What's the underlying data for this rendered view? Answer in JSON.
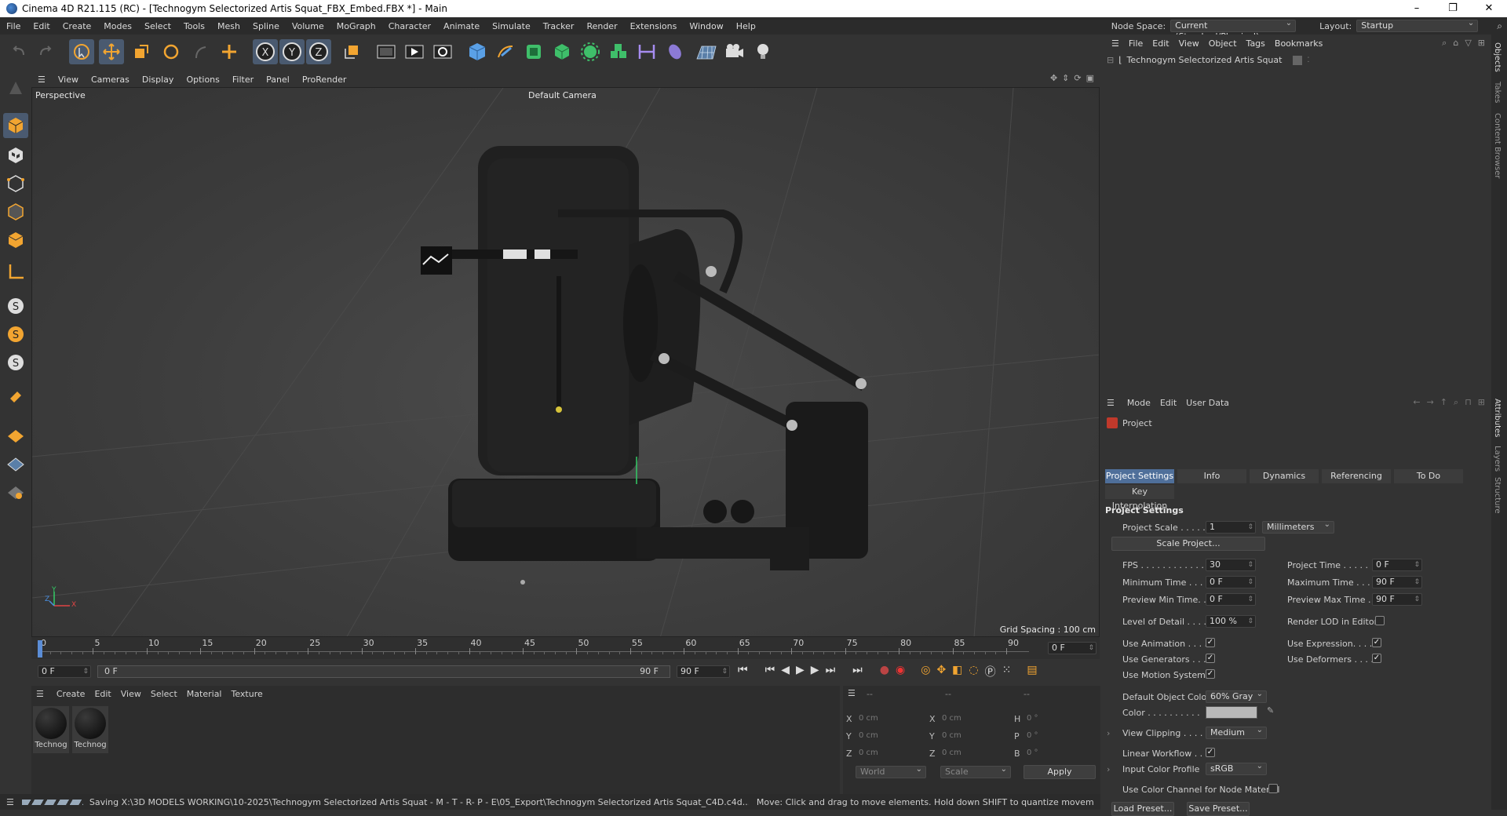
{
  "window": {
    "title": "Cinema 4D R21.115 (RC) - [Technogym Selectorized Artis Squat_FBX_Embed.FBX *] - Main",
    "controls": [
      "–",
      "❐",
      "✕"
    ]
  },
  "menubar": {
    "items": [
      "File",
      "Edit",
      "Create",
      "Modes",
      "Select",
      "Tools",
      "Mesh",
      "Spline",
      "Volume",
      "MoGraph",
      "Character",
      "Animate",
      "Simulate",
      "Tracker",
      "Render",
      "Extensions",
      "Window",
      "Help"
    ],
    "node_space_label": "Node Space:",
    "node_space_value": "Current (Standard/Physical)",
    "layout_label": "Layout:",
    "layout_value": "Startup"
  },
  "viewport": {
    "menu": [
      "View",
      "Cameras",
      "Display",
      "Options",
      "Filter",
      "Panel",
      "ProRender"
    ],
    "view_name": "Perspective",
    "camera": "Default Camera",
    "grid_spacing": "Grid Spacing : 100 cm",
    "axis_labels": {
      "y": "Y",
      "z": "Z",
      "x": "X"
    }
  },
  "timeline": {
    "ticks": [
      "0",
      "5",
      "10",
      "15",
      "20",
      "25",
      "30",
      "35",
      "40",
      "45",
      "50",
      "55",
      "60",
      "65",
      "70",
      "75",
      "80",
      "85",
      "90"
    ],
    "current_frame": "0 F"
  },
  "transport": {
    "start_field": "0 F",
    "range_start": "0 F",
    "range_end": "90 F",
    "end_field": "90 F"
  },
  "materials": {
    "menu": [
      "Create",
      "Edit",
      "View",
      "Select",
      "Material",
      "Texture"
    ],
    "items": [
      "Technog",
      "Technog"
    ]
  },
  "coords": {
    "header": [
      "--",
      "--",
      "--"
    ],
    "rows": [
      {
        "a": "X",
        "a_val": "0 cm",
        "b": "X",
        "b_val": "0 cm",
        "c": "H",
        "c_val": "0 °"
      },
      {
        "a": "Y",
        "a_val": "0 cm",
        "b": "Y",
        "b_val": "0 cm",
        "c": "P",
        "c_val": "0 °"
      },
      {
        "a": "Z",
        "a_val": "0 cm",
        "b": "Z",
        "b_val": "0 cm",
        "c": "B",
        "c_val": "0 °"
      }
    ],
    "world": "World",
    "scale": "Scale",
    "apply": "Apply"
  },
  "status": {
    "saving": "Saving X:\\3D MODELS WORKING\\10-2025\\Technogym Selectorized Artis Squat - M - T - R- P - E\\05_Export\\Technogym Selectorized Artis Squat_C4D.c4d...",
    "hint": "Move: Click and drag to move elements. Hold down SHIFT to quantize movement / add to th"
  },
  "objects": {
    "menu": [
      "File",
      "Edit",
      "View",
      "Object",
      "Tags",
      "Bookmarks"
    ],
    "item": "Technogym Selectorized Artis Squat"
  },
  "attributes": {
    "menu": [
      "Mode",
      "Edit",
      "User Data"
    ],
    "object": "Project",
    "tabs": [
      "Project Settings",
      "Info",
      "Dynamics",
      "Referencing",
      "To Do"
    ],
    "tab2": "Key Interpolation",
    "section": "Project Settings",
    "project_scale_label": "Project Scale . . . . .",
    "project_scale": "1",
    "project_scale_unit": "Millimeters",
    "scale_project_btn": "Scale Project...",
    "fps_label": "FPS . . . . . . . . . . . .",
    "fps": "30",
    "project_time_label": "Project Time . . . . .",
    "project_time": "0 F",
    "min_time_label": "Minimum Time . . . .",
    "min_time": "0 F",
    "max_time_label": "Maximum Time . . .",
    "max_time": "90 F",
    "preview_min_label": "Preview Min Time. .",
    "preview_min": "0 F",
    "preview_max_label": "Preview Max Time . .",
    "preview_max": "90 F",
    "lod_label": "Level of Detail . . . .",
    "lod": "100 %",
    "render_lod_label": "Render LOD in Editor",
    "use_animation_label": "Use Animation . . . .",
    "use_expression_label": "Use Expression. . . .",
    "use_generators_label": "Use Generators . . .",
    "use_deformers_label": "Use Deformers . . . .",
    "use_motion_label": "Use Motion System",
    "default_color_label": "Default Object Color",
    "default_color": "60% Gray",
    "color_label": "Color . . . . . . . . . .",
    "view_clipping_label": "View Clipping . . . .",
    "view_clipping": "Medium",
    "linear_workflow_label": "Linear Workflow . . .",
    "input_profile_label": "Input Color Profile",
    "input_profile": "sRGB",
    "color_channel_label": "Use Color Channel for Node Material",
    "load_preset": "Load Preset...",
    "save_preset": "Save Preset..."
  },
  "side_tabs": [
    "Objects",
    "Takes",
    "Content Browser",
    "Attributes",
    "Layers",
    "Structure"
  ]
}
